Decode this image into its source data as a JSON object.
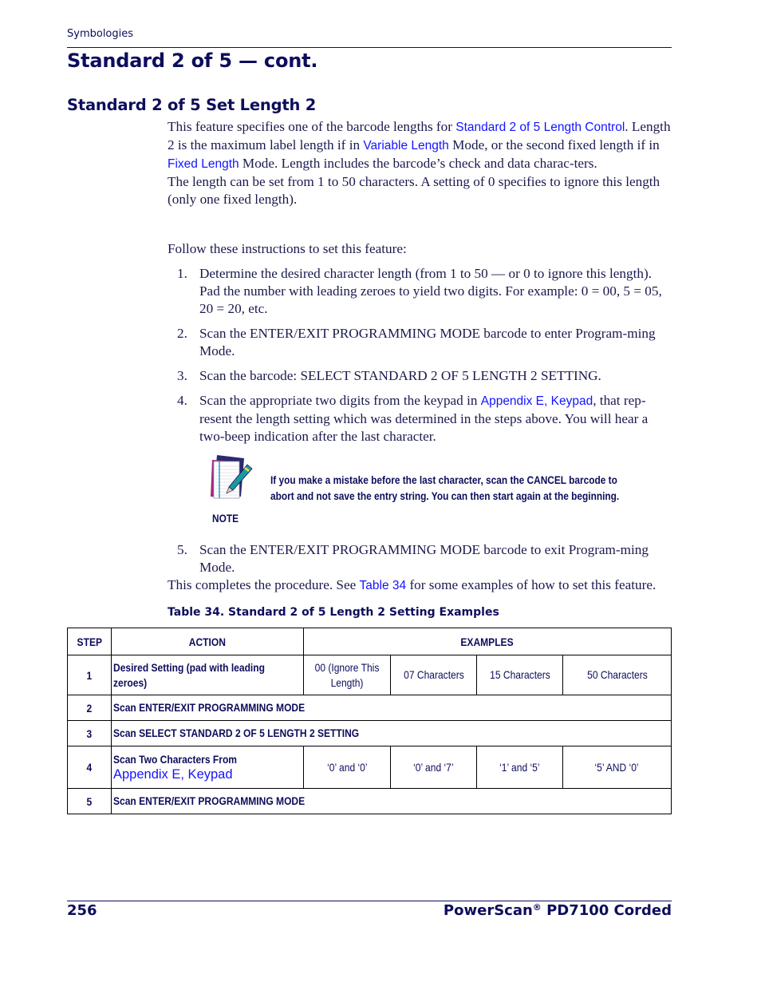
{
  "header": {
    "section": "Symbologies"
  },
  "page_title": "Standard 2 of 5 — cont.",
  "section_title": "Standard 2 of 5 Set Length 2",
  "intro": {
    "p1_a": "This feature specifies one of the barcode lengths for ",
    "p1_link1": "Standard 2 of 5 Length Control",
    "p1_b": ". Length 2 is the maximum label length if in ",
    "p1_link2": "Variable Length",
    "p1_c": " Mode, or the second fixed length if in ",
    "p1_link3": "Fixed Length",
    "p1_d": " Mode. Length includes the barcode’s check and data charac-ters.",
    "p2": "The length can be set from 1 to 50 characters. A setting of 0 specifies to ignore this length (only one fixed length).",
    "p3": "Follow these instructions to set this feature:"
  },
  "steps": [
    {
      "num": "1.",
      "text": "Determine the desired character length (from 1 to 50 — or 0 to ignore this length). Pad the number with leading zeroes to yield two digits. For example: 0 = 00, 5 = 05, 20 = 20, etc."
    },
    {
      "num": "2.",
      "text": "Scan the ENTER/EXIT PROGRAMMING MODE barcode to enter Program-ming Mode."
    },
    {
      "num": "3.",
      "text": "Scan the barcode: SELECT STANDARD 2 OF 5 LENGTH 2 SETTING."
    },
    {
      "num": "4.",
      "text_a": "Scan the appropriate two digits from the keypad in ",
      "link": "Appendix E, Keypad",
      "text_b": ", that rep-resent the length setting which was determined in the steps above. You will hear a two-beep indication after the last character."
    },
    {
      "num": "5.",
      "text": "Scan the ENTER/EXIT PROGRAMMING MODE barcode to exit Program-ming Mode."
    }
  ],
  "note": {
    "icon": "notepad-pen-icon",
    "label": "NOTE",
    "line1": "If you make a mistake before the last character, scan the CANCEL barcode to",
    "line2": "abort and not save the entry string. You can then start again at the beginning."
  },
  "closing": {
    "text_a": "This completes the procedure. See ",
    "link": "Table 34",
    "text_b": " for some examples of how to set this feature."
  },
  "table": {
    "caption": "Table 34. Standard 2 of 5 Length 2 Setting Examples",
    "headers": [
      "STEP",
      "ACTION",
      "EXAMPLES"
    ],
    "rows": [
      {
        "step": "1",
        "action": "Desired Setting (pad with leading zeroes)",
        "examples": [
          "00 (Ignore This Length)",
          "07 Characters",
          "15 Characters",
          "50 Characters"
        ]
      },
      {
        "step": "2",
        "action": "Scan ENTER/EXIT PROGRAMMING MODE"
      },
      {
        "step": "3",
        "action": "Scan SELECT STANDARD 2 OF 5 LENGTH 2 SETTING"
      },
      {
        "step": "4",
        "action": "Scan Two Characters From",
        "action_link": "Appendix E, Keypad",
        "examples": [
          "‘0’ and ‘0’",
          "‘0’ and ‘7’",
          "‘1’ and ‘5’",
          "‘5’ AND ‘0’"
        ]
      },
      {
        "step": "5",
        "action": "Scan ENTER/EXIT PROGRAMMING MODE"
      }
    ]
  },
  "footer": {
    "page_number": "256",
    "product_a": "PowerScan",
    "product_reg": "®",
    "product_b": " PD7100 Corded"
  },
  "colors": {
    "heading_navy": "#0d0d5c",
    "link_blue": "#1414ff",
    "body_text": "#1a1a4e"
  }
}
